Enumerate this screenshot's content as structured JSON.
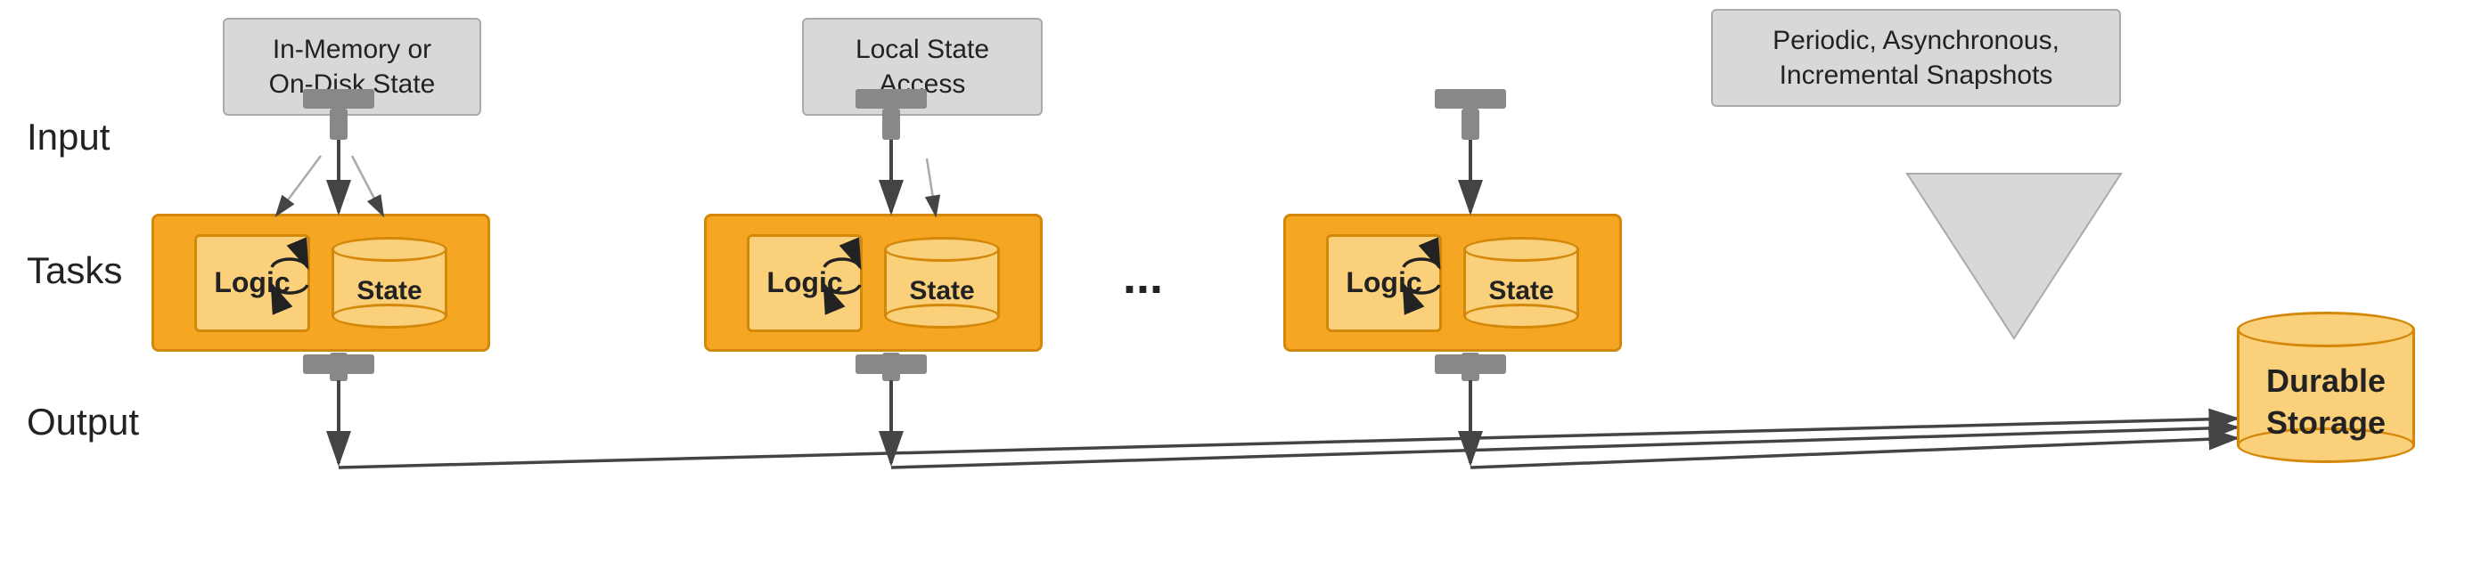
{
  "labels": {
    "input": "Input",
    "tasks": "Tasks",
    "output": "Output"
  },
  "callouts": {
    "callout1": {
      "line1": "In-Memory or",
      "line2": "On-Disk State"
    },
    "callout2": {
      "line1": "Local State",
      "line2": "Access"
    },
    "callout3": {
      "line1": "Periodic, Asynchronous,",
      "line2": "Incremental Snapshots"
    }
  },
  "taskBoxes": [
    {
      "logic": "Logic",
      "state": "State"
    },
    {
      "logic": "Logic",
      "state": "State"
    },
    {
      "logic": "Logic",
      "state": "State"
    }
  ],
  "dots": "...",
  "durableStorage": {
    "line1": "Durable",
    "line2": "Storage"
  }
}
